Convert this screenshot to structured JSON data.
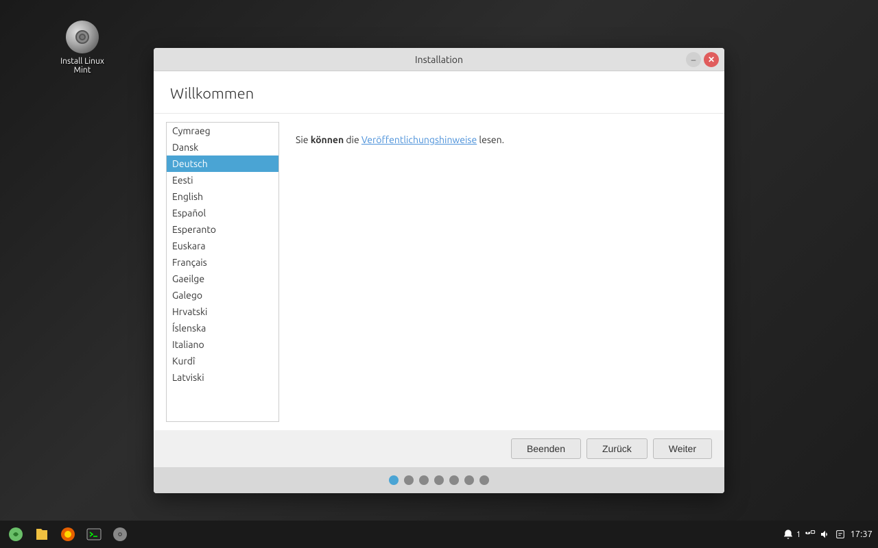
{
  "desktop": {
    "icon_label": "Install Linux Mint"
  },
  "window": {
    "title": "Installation",
    "page_title": "Willkommen",
    "release_notes_text_before": "Sie ",
    "release_notes_bold": "können",
    "release_notes_text_middle": " die ",
    "release_notes_link": "Veröffentlichungshinweise",
    "release_notes_text_after": " lesen."
  },
  "languages": [
    {
      "id": "cymraeg",
      "label": "Cymraeg",
      "selected": false
    },
    {
      "id": "dansk",
      "label": "Dansk",
      "selected": false
    },
    {
      "id": "deutsch",
      "label": "Deutsch",
      "selected": true
    },
    {
      "id": "eesti",
      "label": "Eesti",
      "selected": false
    },
    {
      "id": "english",
      "label": "English",
      "selected": false
    },
    {
      "id": "espanol",
      "label": "Español",
      "selected": false
    },
    {
      "id": "esperanto",
      "label": "Esperanto",
      "selected": false
    },
    {
      "id": "euskara",
      "label": "Euskara",
      "selected": false
    },
    {
      "id": "francais",
      "label": "Français",
      "selected": false
    },
    {
      "id": "gaeilge",
      "label": "Gaeilge",
      "selected": false
    },
    {
      "id": "galego",
      "label": "Galego",
      "selected": false
    },
    {
      "id": "hrvatski",
      "label": "Hrvatski",
      "selected": false
    },
    {
      "id": "islenska",
      "label": "Íslenska",
      "selected": false
    },
    {
      "id": "italiano",
      "label": "Italiano",
      "selected": false
    },
    {
      "id": "kurdi",
      "label": "Kurdî",
      "selected": false
    },
    {
      "id": "latviski",
      "label": "Latviski",
      "selected": false
    }
  ],
  "buttons": {
    "quit": "Beenden",
    "back": "Zurück",
    "forward": "Weiter"
  },
  "progress": {
    "total": 7,
    "active": 0
  },
  "taskbar": {
    "time": "17:37",
    "notification_count": "1"
  }
}
